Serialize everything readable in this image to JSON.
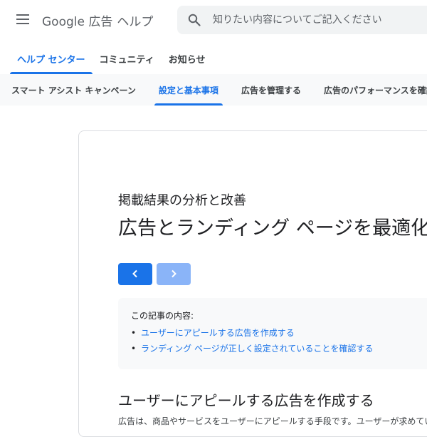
{
  "header": {
    "menu_icon": "hamburger-menu-icon",
    "logo_brand": "Google 広告",
    "logo_sub": "ヘルプ",
    "search": {
      "placeholder": "知りたい内容についてご記入ください",
      "icon": "search-icon"
    }
  },
  "primary_tabs": [
    {
      "label": "ヘルプ センター",
      "active": true
    },
    {
      "label": "コミュニティ",
      "active": false
    },
    {
      "label": "お知らせ",
      "active": false
    }
  ],
  "secondary_tabs": [
    {
      "label": "スマート アシスト キャンペーン",
      "active": false
    },
    {
      "label": "設定と基本事項",
      "active": true
    },
    {
      "label": "広告を管理する",
      "active": false
    },
    {
      "label": "広告のパフォーマンスを確認",
      "active": false
    }
  ],
  "article": {
    "breadcrumb_title": "掲載結果の分析と改善",
    "title": "広告とランディング ページを最適化",
    "prev_icon": "chevron-left-icon",
    "next_icon": "chevron-right-icon",
    "toc": {
      "heading": "この記事の内容:",
      "bullet": "•",
      "items": [
        "ユーザーにアピールする広告を作成する",
        "ランディング ページが正しく設定されていることを確認する"
      ]
    },
    "section_heading": "ユーザーにアピールする広告を作成する",
    "body_text": "広告は、商品やサービスをユーザーにアピールする手段です。ユーザーが求めてい"
  },
  "colors": {
    "accent": "#1a73e8",
    "accent_light": "#8ab4f8",
    "text": "#202124",
    "muted": "#5f6368",
    "panel": "#f8f9fa"
  }
}
